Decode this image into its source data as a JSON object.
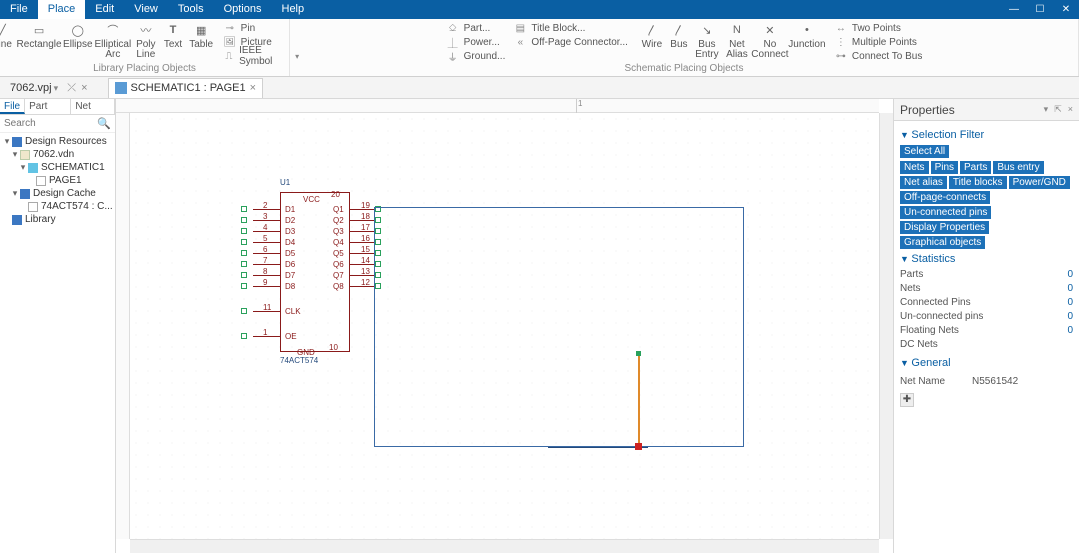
{
  "menu": {
    "items": [
      "File",
      "Place",
      "Edit",
      "View",
      "Tools",
      "Options",
      "Help"
    ],
    "active": 1
  },
  "ribbon": {
    "group1_label": "Library Placing Objects",
    "g1_btns": [
      {
        "label": "Line"
      },
      {
        "label": "Rectangle"
      },
      {
        "label": "Ellipse"
      },
      {
        "label": "Elliptical\nArc"
      },
      {
        "label": "Poly\nLine"
      },
      {
        "label": "Text"
      },
      {
        "label": "Table"
      }
    ],
    "g1b": [
      {
        "label": "Pin"
      },
      {
        "label": "Picture"
      },
      {
        "label": "IEEE Symbol"
      }
    ],
    "group2_label": "Schematic Placing Objects",
    "g2a": [
      {
        "label": "Part..."
      },
      {
        "label": "Power..."
      },
      {
        "label": "Ground..."
      }
    ],
    "g2b": [
      {
        "label": "Title Block..."
      },
      {
        "label": "Off-Page Connector..."
      }
    ],
    "g2c_btns": [
      {
        "label": "Wire"
      },
      {
        "label": "Bus"
      },
      {
        "label": "Bus\nEntry"
      },
      {
        "label": "Net\nAlias"
      },
      {
        "label": "No\nConnect"
      },
      {
        "label": "Junction"
      }
    ],
    "g2d": [
      {
        "label": "Two Points"
      },
      {
        "label": "Multiple Points"
      },
      {
        "label": "Connect To Bus"
      }
    ]
  },
  "projbar": {
    "project_tab": "7062.vpj",
    "doc_tab": "SCHEMATIC1 : PAGE1",
    "close_glyph": "×"
  },
  "leftpanel": {
    "tabs": [
      "File",
      "Part Tree",
      "Net Tree"
    ],
    "search_placeholder": "Search",
    "tree": [
      {
        "d": 1,
        "tw": "▾",
        "ico": "folder-blue",
        "label": "Design Resources"
      },
      {
        "d": 2,
        "tw": "▾",
        "ico": "doc-ico",
        "label": "7062.vdn"
      },
      {
        "d": 3,
        "tw": "▾",
        "ico": "folder-cyan",
        "label": "SCHEMATIC1"
      },
      {
        "d": 4,
        "tw": "",
        "ico": "page-ico",
        "label": "PAGE1"
      },
      {
        "d": 2,
        "tw": "▾",
        "ico": "folder-blue",
        "label": "Design Cache"
      },
      {
        "d": 3,
        "tw": "",
        "ico": "page-ico",
        "label": "74ACT574 : C..."
      },
      {
        "d": 1,
        "tw": "",
        "ico": "folder-blue",
        "label": "Library"
      }
    ]
  },
  "ruler": {
    "ticks": [
      {
        "pos": 460,
        "label": "1"
      }
    ]
  },
  "component": {
    "ref": "U1",
    "value": "74ACT574",
    "vcc_label": "VCC",
    "vcc_pin": "20",
    "gnd_label": "GND",
    "gnd_pin": "10",
    "left_pins": [
      {
        "num": "2",
        "name": "D1"
      },
      {
        "num": "3",
        "name": "D2"
      },
      {
        "num": "4",
        "name": "D3"
      },
      {
        "num": "5",
        "name": "D4"
      },
      {
        "num": "6",
        "name": "D5"
      },
      {
        "num": "7",
        "name": "D6"
      },
      {
        "num": "8",
        "name": "D7"
      },
      {
        "num": "9",
        "name": "D8"
      },
      {
        "num": "11",
        "name": "CLK"
      },
      {
        "num": "1",
        "name": "OE"
      }
    ],
    "right_pins": [
      {
        "num": "19",
        "name": "Q1"
      },
      {
        "num": "18",
        "name": "Q2"
      },
      {
        "num": "17",
        "name": "Q3"
      },
      {
        "num": "16",
        "name": "Q4"
      },
      {
        "num": "15",
        "name": "Q5"
      },
      {
        "num": "14",
        "name": "Q6"
      },
      {
        "num": "13",
        "name": "Q7"
      },
      {
        "num": "12",
        "name": "Q8"
      }
    ]
  },
  "properties": {
    "title": "Properties",
    "sections": {
      "filter": "Selection Filter",
      "stats": "Statistics",
      "general": "General"
    },
    "select_all": "Select All",
    "tags": [
      "Nets",
      "Pins",
      "Parts",
      "Bus entry",
      "Net alias",
      "Title blocks",
      "Power/GND",
      "Off-page-connects",
      "Un-connected pins",
      "Display Properties",
      "Graphical objects"
    ],
    "stats": [
      {
        "label": "Parts",
        "value": "0"
      },
      {
        "label": "Nets",
        "value": "0"
      },
      {
        "label": "Connected Pins",
        "value": "0"
      },
      {
        "label": "Un-connected pins",
        "value": "0"
      },
      {
        "label": "Floating Nets",
        "value": "0"
      },
      {
        "label": "DC Nets",
        "value": ""
      }
    ],
    "net_name_label": "Net Name",
    "net_name_value": "N5561542"
  }
}
